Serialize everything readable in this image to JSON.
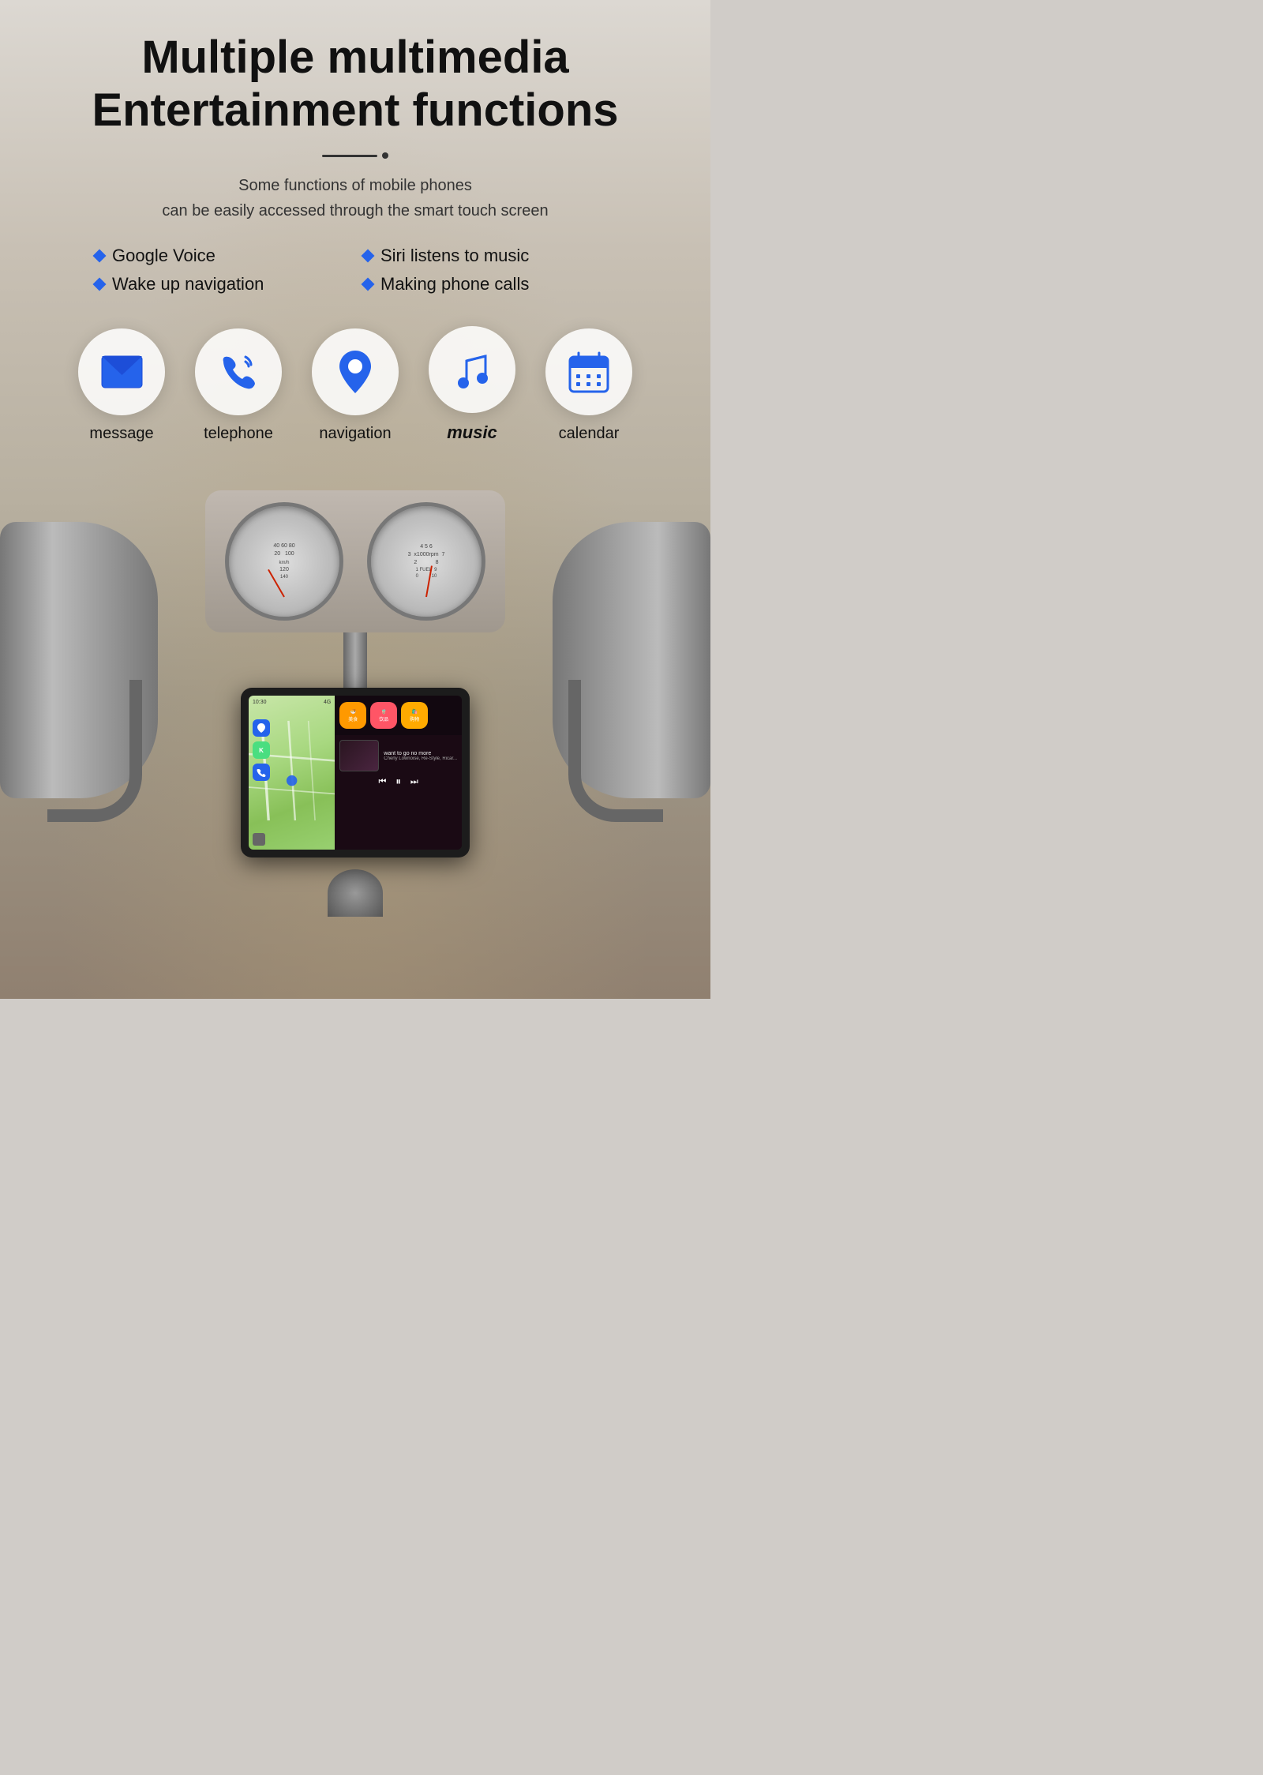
{
  "title": {
    "line1": "Multiple multimedia",
    "line2": "Entertainment functions"
  },
  "subtitle": {
    "line1": "Some functions of mobile phones",
    "line2": "can be easily accessed through the smart touch screen"
  },
  "features": [
    {
      "id": "google-voice",
      "label": "Google Voice"
    },
    {
      "id": "siri-music",
      "label": "Siri listens to music"
    },
    {
      "id": "navigation",
      "label": "Wake up navigation"
    },
    {
      "id": "phone-calls",
      "label": "Making phone calls"
    }
  ],
  "icons": [
    {
      "id": "message",
      "label": "message"
    },
    {
      "id": "telephone",
      "label": "telephone"
    },
    {
      "id": "navigation",
      "label": "navigation"
    },
    {
      "id": "music",
      "label": "music",
      "is_music": true
    },
    {
      "id": "calendar",
      "label": "calendar"
    }
  ],
  "device": {
    "time": "10:30",
    "signal": "4G",
    "music_title": "want to go no more",
    "music_artist": "Cherly Lownoise, Re-Style, Ricar...",
    "app_icons": [
      "美食",
      "饮品",
      "购物"
    ]
  },
  "colors": {
    "accent_blue": "#2563eb",
    "title_dark": "#111111",
    "background_light": "#e8e4e0"
  }
}
